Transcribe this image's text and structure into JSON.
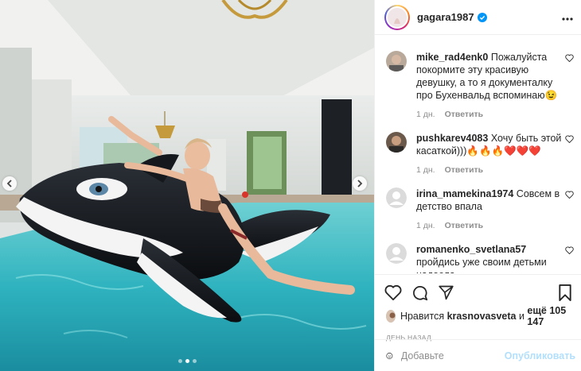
{
  "post": {
    "username": "gagara1987",
    "verified": true,
    "more_icon": "more-horizontal-icon"
  },
  "carousel": {
    "total_slides": 3,
    "active_slide": 2,
    "prev_icon": "chevron-left-icon",
    "next_icon": "chevron-right-icon"
  },
  "comments": [
    {
      "user": "mike_rad4enk0",
      "text": "Пожалуйста покормите эту красивую девушку, а то я документалку про Бухенвальд вспоминаю😉",
      "age": "1 дн.",
      "reply": "Ответить"
    },
    {
      "user": "pushkarev4083",
      "text": "Хочу быть этой касаткой)))🔥🔥🔥❤️❤️❤️",
      "age": "1 дн.",
      "reply": "Ответить"
    },
    {
      "user": "irina_mamekina1974",
      "text": "Совсем в детство впала",
      "age": "1 дн.",
      "reply": "Ответить"
    },
    {
      "user": "romanenko_svetlana57",
      "text": "пройдись уже своим детьми надоела",
      "age": "",
      "reply": ""
    }
  ],
  "likes": {
    "prefix": "Нравится",
    "user": "krasnovasveta",
    "middle": "и",
    "others": "ещё 105 147"
  },
  "time_ago": "ДЕНЬ НАЗАД",
  "composer": {
    "placeholder": "Добавьте",
    "publish_label": "Опубликовать"
  },
  "colors": {
    "verified_blue": "#0095f6",
    "publish_disabled": "#b2dffc",
    "meta_gray": "#8e8e8e",
    "pool_water": "#3fb9c4"
  }
}
